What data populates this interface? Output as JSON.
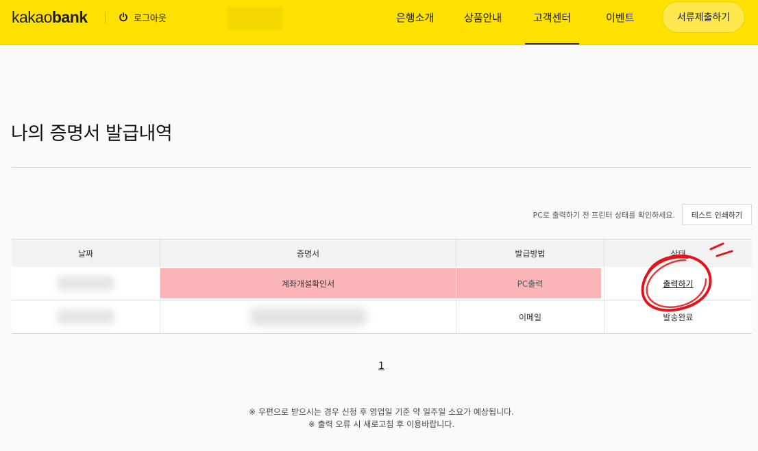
{
  "header": {
    "logo_light": "kakao",
    "logo_bold": "bank",
    "logout_label": "로그아웃",
    "nav": [
      {
        "label": "은행소개"
      },
      {
        "label": "상품안내"
      },
      {
        "label": "고객센터"
      },
      {
        "label": "이벤트"
      }
    ],
    "active_nav": "고객센터",
    "submit_label": "서류제출하기",
    "brand_color": "#ffe100"
  },
  "page": {
    "title": "나의 증명서 발급내역",
    "printer_notice": "PC로 출력하기 전 프린터 상태를 확인하세요.",
    "test_print_label": "테스트 인쇄하기"
  },
  "table": {
    "headers": [
      "날짜",
      "증명서",
      "발급방법",
      "상태"
    ],
    "rows": [
      {
        "date": "",
        "document": "계좌개설확인서",
        "method": "PC출력",
        "status": "출력하기",
        "highlight_color": "#fbb4b8"
      },
      {
        "date": "",
        "document": "",
        "method": "이메일",
        "status": "발송완료"
      }
    ]
  },
  "pagination": {
    "current_page": "1"
  },
  "footnotes": [
    "※ 우편으로 받으시는 경우 신청 후 영업일 기준 약 일주일 소요가 예상됩니다.",
    "※ 출력 오류 시 새로고침 후 이용바랍니다."
  ],
  "icons": {
    "logout": "power-icon"
  }
}
